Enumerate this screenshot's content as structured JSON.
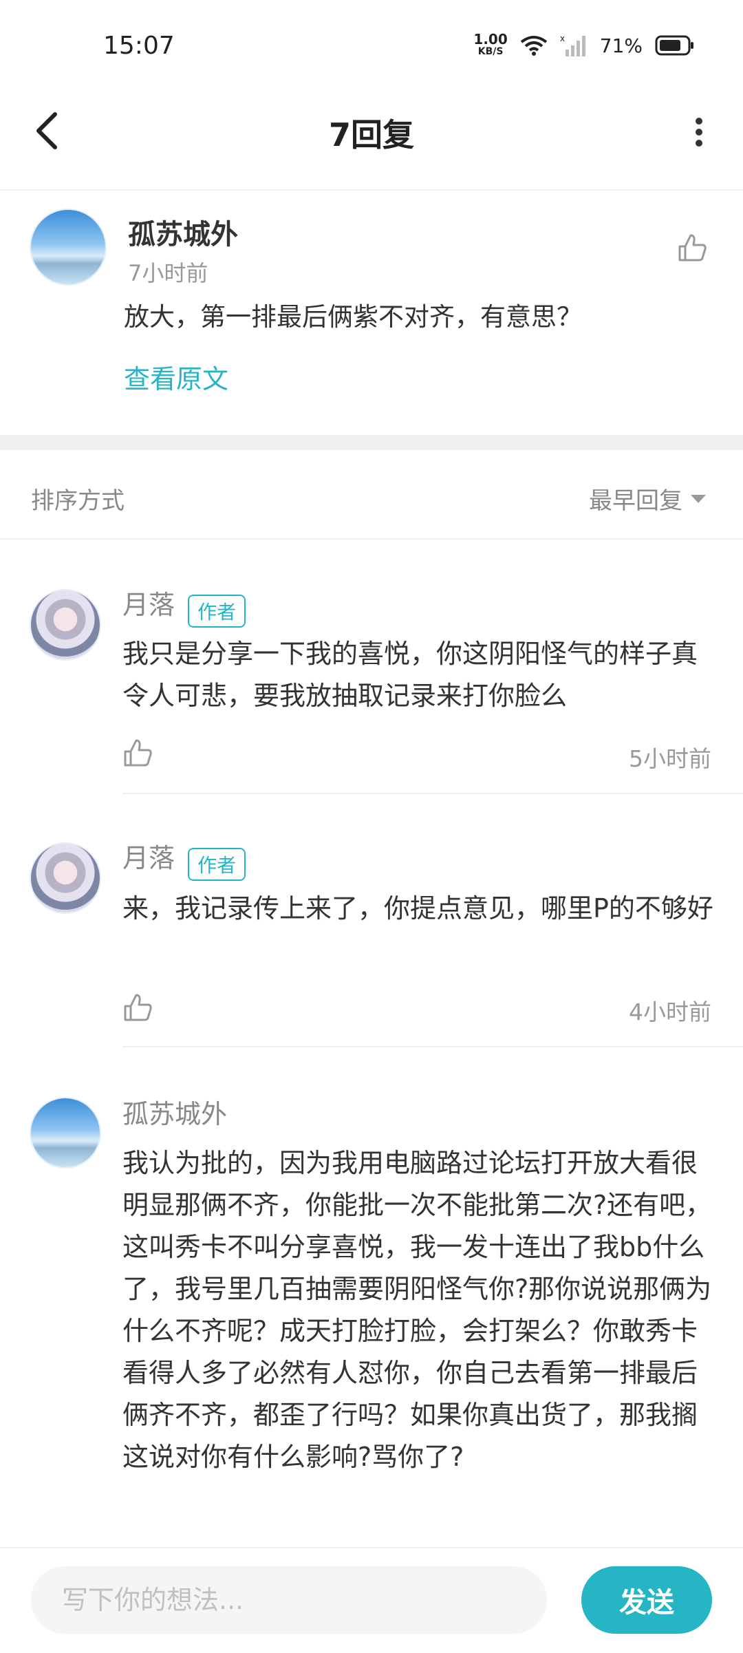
{
  "status_bar": {
    "time": "15:07",
    "network_speed_value": "1.00",
    "network_speed_unit": "KB/S",
    "battery_percent": "71%",
    "icons": [
      "wifi-icon",
      "signal-icon",
      "battery-icon"
    ]
  },
  "header": {
    "title": "7回复",
    "icons": [
      "back-arrow-icon",
      "more-vertical-icon"
    ]
  },
  "post": {
    "author": "孤苏城外",
    "time": "7小时前",
    "content": "放大，第一排最后俩紫不对齐，有意思？",
    "view_original": "查看原文"
  },
  "sort": {
    "label": "排序方式",
    "value": "最早回复"
  },
  "replies": [
    {
      "author": "月落",
      "badge": "作者",
      "content": "我只是分享一下我的喜悦，你这阴阳怪气的样子真令人可悲，要我放抽取记录来打你脸么",
      "time": "5小时前"
    },
    {
      "author": "月落",
      "badge": "作者",
      "content": "来，我记录传上来了，你提点意见，哪里P的不够好",
      "time": "4小时前"
    },
    {
      "author": "孤苏城外",
      "content": "我认为批的，因为我用电脑路过论坛打开放大看很明显那俩不齐，你能批一次不能批第二次?还有吧，这叫秀卡不叫分享喜悦，我一发十连出了我bb什么了，我号里几百抽需要阴阳怪气你?那你说说那俩为什么不齐呢？成天打脸打脸，会打架么？你敢秀卡看得人多了必然有人怼你，你自己去看第一排最后俩齐不齐，都歪了行吗？如果你真出货了，那我搁这说对你有什么影响?骂你了?"
    }
  ],
  "composer": {
    "placeholder": "写下你的想法...",
    "send_label": "发送"
  },
  "colors": {
    "accent": "#26b5c4",
    "divider": "#efefef",
    "muted_text": "#999999"
  }
}
